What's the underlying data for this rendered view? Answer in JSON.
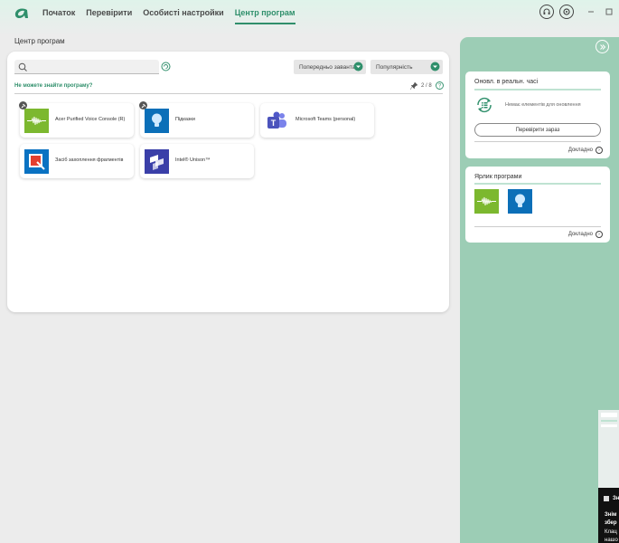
{
  "nav": {
    "items": [
      {
        "label": "Початок",
        "active": false
      },
      {
        "label": "Перевірити",
        "active": false
      },
      {
        "label": "Особисті настройки",
        "active": false
      },
      {
        "label": "Центр програм",
        "active": true
      }
    ]
  },
  "colors": {
    "accent": "#2f8f6b",
    "panel": "#9ccdb5"
  },
  "page": {
    "title": "Центр програм"
  },
  "search": {
    "value": "",
    "placeholder": ""
  },
  "filters": {
    "preinstalled_label": "Попередньо завантаж.",
    "popularity_label": "Популярність"
  },
  "help_link": "Не можете знайти програму?",
  "pinned_count": "2 / 8",
  "apps": [
    {
      "name": "Acer Purified Voice Console (R)",
      "icon": "voice-wave-icon",
      "pinned": true
    },
    {
      "name": "Підказки",
      "icon": "lightbulb-icon",
      "pinned": true
    },
    {
      "name": "Microsoft Teams (personal)",
      "icon": "teams-icon",
      "pinned": false
    },
    {
      "name": "Засіб захоплення фрагментів",
      "icon": "snipping-tool-icon",
      "pinned": false
    },
    {
      "name": "Intel® Unison™",
      "icon": "unison-icon",
      "pinned": false
    }
  ],
  "updates_card": {
    "title": "Оновл. в реальн. часі",
    "no_items": "Немає елементів для оновлення",
    "check_button": "Перевірити зараз",
    "more_link": "Докладно"
  },
  "shortcuts_card": {
    "title": "Ярлик програми",
    "more_link": "Докладно",
    "icons": [
      "voice-wave-icon",
      "lightbulb-icon"
    ]
  },
  "thumbnail": {
    "line1": "Знім",
    "line2": "збер",
    "line3": "Клац",
    "line4": "нашо"
  }
}
